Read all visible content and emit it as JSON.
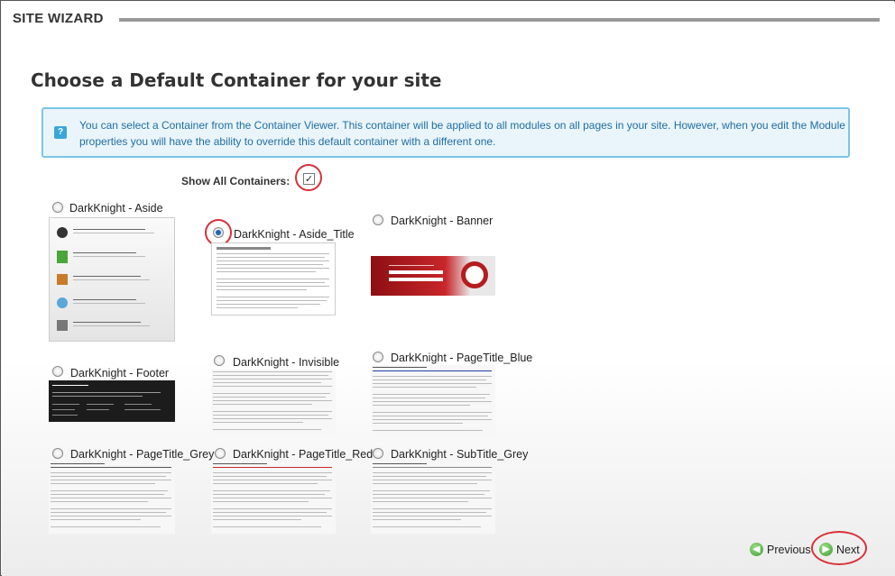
{
  "header": {
    "title": "SITE WIZARD"
  },
  "page": {
    "title": "Choose a Default Container for your site"
  },
  "info": {
    "icon": "help-icon",
    "text": "You can select a Container from the Container Viewer. This container will be applied to all modules on all pages in your site. However, when you edit the Module properties you will have the ability to override this default container with a different one."
  },
  "show_all": {
    "label": "Show All Containers:",
    "checked": true
  },
  "containers": [
    {
      "label": "DarkKnight - Aside",
      "selected": false
    },
    {
      "label": "DarkKnight - Aside_Title",
      "selected": true
    },
    {
      "label": "DarkKnight - Banner",
      "selected": false
    },
    {
      "label": "DarkKnight - Footer",
      "selected": false
    },
    {
      "label": "DarkKnight - Invisible",
      "selected": false
    },
    {
      "label": "DarkKnight - PageTitle_Blue",
      "selected": false
    },
    {
      "label": "DarkKnight - PageTitle_Grey",
      "selected": false
    },
    {
      "label": "DarkKnight - PageTitle_Red",
      "selected": false
    },
    {
      "label": "DarkKnight - SubTitle_Grey",
      "selected": false
    }
  ],
  "nav": {
    "previous_label": "Previous",
    "next_label": "Next"
  },
  "colors": {
    "accent_red": "#d9313a",
    "info_border": "#7cc5e6",
    "info_text": "#1f6da0",
    "nav_green": "#3a9a2c"
  }
}
